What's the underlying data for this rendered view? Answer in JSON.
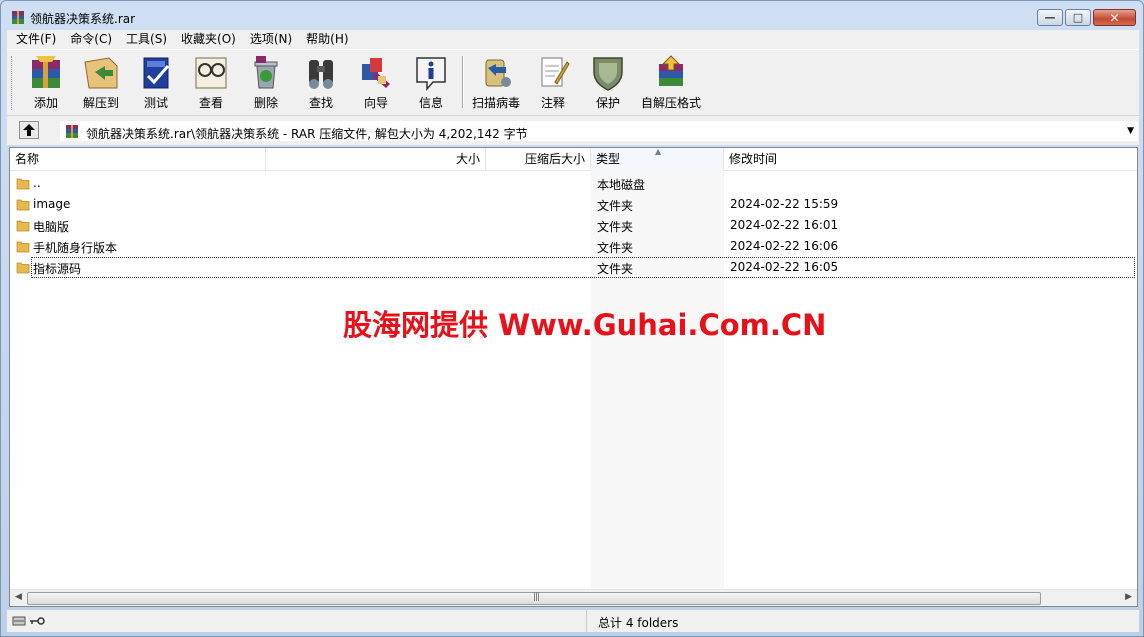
{
  "window": {
    "title": "领航器决策系统.rar",
    "controls": {
      "minimize": "—",
      "maximize": "□",
      "close": "✕"
    }
  },
  "menu": [
    "文件(F)",
    "命令(C)",
    "工具(S)",
    "收藏夹(O)",
    "选项(N)",
    "帮助(H)"
  ],
  "toolbar": {
    "buttons": [
      {
        "label": "添加",
        "icon": "add-archive-icon"
      },
      {
        "label": "解压到",
        "icon": "extract-icon"
      },
      {
        "label": "测试",
        "icon": "test-icon"
      },
      {
        "label": "查看",
        "icon": "view-icon"
      },
      {
        "label": "删除",
        "icon": "delete-icon"
      },
      {
        "label": "查找",
        "icon": "find-icon"
      },
      {
        "label": "向导",
        "icon": "wizard-icon"
      },
      {
        "label": "信息",
        "icon": "info-icon"
      },
      {
        "label": "扫描病毒",
        "icon": "virus-scan-icon"
      },
      {
        "label": "注释",
        "icon": "comment-icon"
      },
      {
        "label": "保护",
        "icon": "protect-icon"
      },
      {
        "label": "自解压格式",
        "icon": "sfx-icon"
      }
    ]
  },
  "address": {
    "path": "领航器决策系统.rar\\领航器决策系统 - RAR 压缩文件, 解包大小为 4,202,142 字节"
  },
  "columns": {
    "name": "名称",
    "size": "大小",
    "packed": "压缩后大小",
    "type": "类型",
    "modified": "修改时间"
  },
  "files": [
    {
      "name": "..",
      "size": "",
      "packed": "",
      "type": "本地磁盘",
      "modified": ""
    },
    {
      "name": "image",
      "size": "",
      "packed": "",
      "type": "文件夹",
      "modified": "2024-02-22 15:59"
    },
    {
      "name": "电脑版",
      "size": "",
      "packed": "",
      "type": "文件夹",
      "modified": "2024-02-22 16:01"
    },
    {
      "name": "手机随身行版本",
      "size": "",
      "packed": "",
      "type": "文件夹",
      "modified": "2024-02-22 16:06"
    },
    {
      "name": "指标源码",
      "size": "",
      "packed": "",
      "type": "文件夹",
      "modified": "2024-02-22 16:05"
    }
  ],
  "watermark": "股海网提供 Www.Guhai.Com.CN",
  "status": {
    "summary": "总计 4 folders"
  },
  "colors": {
    "watermark": "#e8111a",
    "folder": "#e7b94a",
    "window_frame": "#bcd0ea"
  }
}
